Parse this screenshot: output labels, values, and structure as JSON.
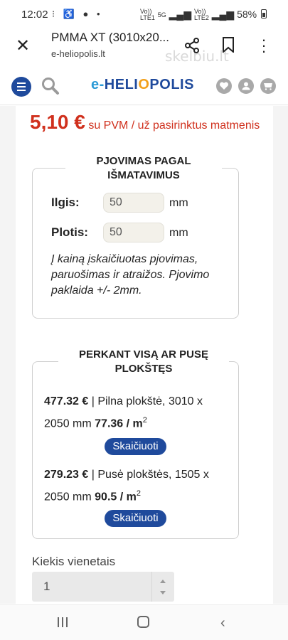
{
  "status_bar": {
    "time": "12:02",
    "left_icons": "⁝ ♿ ● •",
    "net_a": "Vo))",
    "net_a2": "LTE1",
    "net_b": "5G",
    "net_c": "Vo))",
    "net_c2": "LTE2",
    "battery": "58%"
  },
  "browser": {
    "title": "PMMA XT (3010x20...",
    "url": "e-heliopolis.lt",
    "watermark": "skelbiu.lt"
  },
  "site": {
    "logo_dash": "e-",
    "logo_a": "HELI",
    "logo_o": "O",
    "logo_b": "POLIS"
  },
  "price": {
    "amount": "5,10 €",
    "suffix": "su PVM / už pasirinktus matmenis"
  },
  "cutting": {
    "title_line1": "PJOVIMAS PAGAL",
    "title_line2": "IŠMATAVIMUS",
    "length_label": "Ilgis:",
    "length_value": "50",
    "width_label": "Plotis:",
    "width_value": "50",
    "unit": "mm",
    "note": "Į kainą įskaičiuotas pjovimas, paruošimas ir atraižos. Pjovimo paklaida +/- 2mm."
  },
  "sheets": {
    "title_line1": "PERKANT VISĄ AR PUSĘ",
    "title_line2": "PLOKŠTĘS",
    "full": {
      "price": "477.32 €",
      "desc": " | Pilna plokštė, 3010 x 2050 mm ",
      "per_m2": "77.36 / m",
      "sup": "2",
      "button": "Skaičiuoti"
    },
    "half": {
      "price": "279.23 €",
      "desc": " | Pusė plokštės, 1505 x 2050 mm ",
      "per_m2": "90.5 / m",
      "sup": "2",
      "button": "Skaičiuoti"
    }
  },
  "quantity": {
    "label": "Kiekis vienetais",
    "value": "1"
  }
}
